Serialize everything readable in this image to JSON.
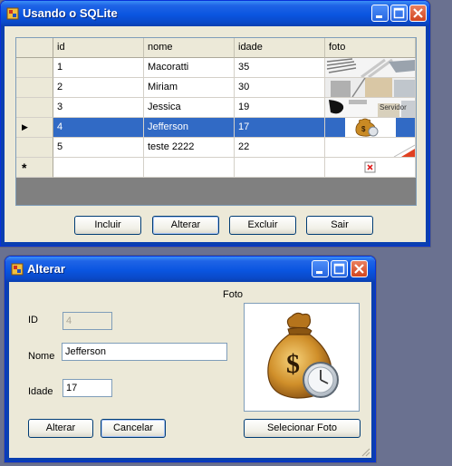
{
  "main_window": {
    "title": "Usando o SQLite",
    "grid": {
      "columns": [
        "id",
        "nome",
        "idade",
        "foto"
      ],
      "rows": [
        {
          "id": "1",
          "nome": "Macoratti",
          "idade": "35",
          "selected": false
        },
        {
          "id": "2",
          "nome": "Miriam",
          "idade": "30",
          "selected": false
        },
        {
          "id": "3",
          "nome": "Jessica",
          "idade": "19",
          "selected": false
        },
        {
          "id": "4",
          "nome": "Jefferson",
          "idade": "17",
          "selected": true
        },
        {
          "id": "5",
          "nome": "teste 2222",
          "idade": "22",
          "selected": false
        }
      ],
      "new_row_marker": "*",
      "current_row_marker": "▶",
      "photo_thumb_text": "Servidor"
    },
    "buttons": {
      "incluir": "Incluir",
      "alterar": "Alterar",
      "excluir": "Excluir",
      "sair": "Sair"
    }
  },
  "dialog": {
    "title": "Alterar",
    "fields": {
      "id_label": "ID",
      "id_value": "4",
      "nome_label": "Nome",
      "nome_value": "Jefferson",
      "idade_label": "Idade",
      "idade_value": "17",
      "foto_label": "Foto"
    },
    "buttons": {
      "alterar": "Alterar",
      "cancelar": "Cancelar",
      "selecionar_foto": "Selecionar Foto"
    }
  },
  "colors": {
    "title_bar": "#0a55e0",
    "selection": "#316ac5",
    "desktop": "#6a7190"
  },
  "icons": [
    "app-icon",
    "minimize-icon",
    "maximize-icon",
    "close-icon",
    "money-bag-clock-icon",
    "broken-image-icon"
  ]
}
